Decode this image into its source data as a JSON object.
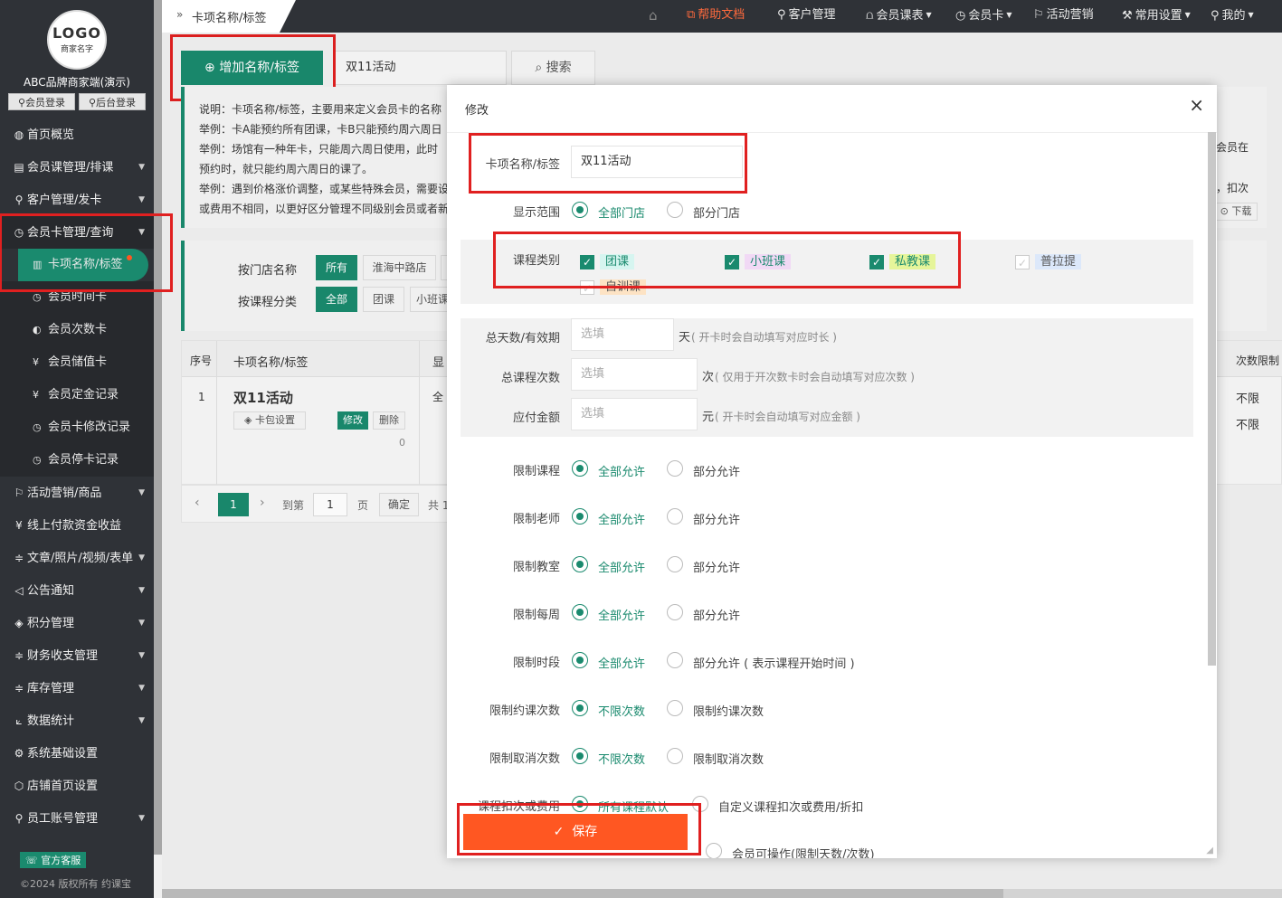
{
  "sidebar": {
    "logo_text": "LOGO",
    "logo_sub": "商家名字",
    "brand": "ABC品牌商家端(演示)",
    "member_login": "会员登录",
    "admin_login": "后台登录",
    "items": [
      {
        "icon": "globe-icon",
        "glyph": "◍",
        "label": "首页概览",
        "caret": false
      },
      {
        "icon": "course-icon",
        "glyph": "▤",
        "label": "会员课管理/排课",
        "caret": true
      },
      {
        "icon": "user-icon",
        "glyph": "⚲",
        "label": "客户管理/发卡",
        "caret": true
      },
      {
        "icon": "clock-icon",
        "glyph": "◷",
        "label": "会员卡管理/查询",
        "caret": true
      }
    ],
    "subitems": [
      {
        "glyph": "▥",
        "label": "卡项名称/标签"
      },
      {
        "glyph": "◷",
        "label": "会员时间卡"
      },
      {
        "glyph": "◐",
        "label": "会员次数卡"
      },
      {
        "glyph": "¥",
        "label": "会员储值卡"
      },
      {
        "glyph": "¥",
        "label": "会员定金记录"
      },
      {
        "glyph": "◷",
        "label": "会员卡修改记录"
      },
      {
        "glyph": "◷",
        "label": "会员停卡记录"
      }
    ],
    "items2": [
      {
        "glyph": "⚐",
        "label": "活动营销/商品",
        "caret": true
      },
      {
        "glyph": "¥",
        "label": "线上付款资金收益",
        "caret": false
      },
      {
        "glyph": "≑",
        "label": "文章/照片/视频/表单",
        "caret": true
      },
      {
        "glyph": "◁",
        "label": "公告通知",
        "caret": true
      },
      {
        "glyph": "◈",
        "label": "积分管理",
        "caret": true
      },
      {
        "glyph": "≑",
        "label": "财务收支管理",
        "caret": true
      },
      {
        "glyph": "≑",
        "label": "库存管理",
        "caret": true
      },
      {
        "glyph": "⟀",
        "label": "数据统计",
        "caret": true
      },
      {
        "glyph": "⚙",
        "label": "系统基础设置",
        "caret": false
      },
      {
        "glyph": "⬡",
        "label": "店铺首页设置",
        "caret": false
      },
      {
        "glyph": "⚲",
        "label": "员工账号管理",
        "caret": true
      }
    ],
    "service": "官方客服",
    "copyright": "©2024 版权所有 约课宝"
  },
  "topbar": {
    "breadcrumb": "卡项名称/标签",
    "home": "⌂",
    "nav": [
      {
        "label": "帮助文档",
        "glyph": "⧉",
        "caret": false,
        "highlight": true
      },
      {
        "label": "客户管理",
        "glyph": "⚲",
        "caret": false,
        "highlight": false
      },
      {
        "label": "会员课表",
        "glyph": "⩍",
        "caret": true,
        "highlight": false
      },
      {
        "label": "会员卡",
        "glyph": "◷",
        "caret": true,
        "highlight": false
      },
      {
        "label": "活动营销",
        "glyph": "⚐",
        "caret": false,
        "highlight": false
      },
      {
        "label": "常用设置",
        "glyph": "⚒",
        "caret": true,
        "highlight": false
      },
      {
        "label": "我的",
        "glyph": "⚲",
        "caret": true,
        "highlight": false
      }
    ]
  },
  "main": {
    "add_button": "增加名称/标签",
    "search_value": "双11活动",
    "search_button": "搜索",
    "notes": [
      "说明：卡项名称/标签，主要用来定义会员卡的名称",
      "举例：卡A能预约所有团课，卡B只能预约周六周日",
      "举例：场馆有一种年卡，只能周六周日使用，此时",
      "预约时，就只能约周六周日的课了。",
      "举例：遇到价格涨价调整，或某些特殊会员，需要设",
      "或费用不相同，以更好区分管理不同级别会员或者新"
    ],
    "note_right_1": "会员在",
    "note_right_2": "，扣次",
    "download": "下载",
    "filter_store_label": "按门店名称",
    "filter_store_options": [
      "所有",
      "淮海中路店"
    ],
    "filter_course_label": "按课程分类",
    "filter_course_options": [
      "全部",
      "团课",
      "小班课"
    ],
    "table": {
      "headers": [
        "序号",
        "卡项名称/标签",
        "显"
      ],
      "right_header": "次数限制",
      "row": {
        "index": "1",
        "name": "双11活动",
        "wallet": "卡包设置",
        "edit": "修改",
        "delete": "删除",
        "count": "0",
        "scope": "全",
        "limit1": "不限",
        "limit2": "不限"
      }
    },
    "pager": {
      "current": "1",
      "goto": "到第",
      "page_input": "1",
      "page": "页",
      "confirm": "确定",
      "total": "共 1"
    }
  },
  "modal": {
    "title": "修改",
    "close": "×",
    "name_label": "卡项名称/标签",
    "name_value": "双11活动",
    "scope_label": "显示范围",
    "scope_options": [
      "全部门店",
      "部分门店"
    ],
    "course_label": "课程类别",
    "courses": [
      {
        "label": "团课",
        "checked": true,
        "bg": "#d6f5f0"
      },
      {
        "label": "小班课",
        "checked": true,
        "bg": "#f1d9f5"
      },
      {
        "label": "私教课",
        "checked": true,
        "bg": "#e6f59a"
      },
      {
        "label": "普拉提",
        "checked": false,
        "bg": "#dce8fa"
      },
      {
        "label": "自训课",
        "checked": false,
        "bg": "#fde3c4"
      }
    ],
    "days_label": "总天数/有效期",
    "days_placeholder": "选填",
    "days_unit": "天",
    "days_hint": "( 开卡时会自动填写对应时长 )",
    "times_label": "总课程次数",
    "times_placeholder": "选填",
    "times_unit": "次",
    "times_hint": "( 仅用于开次数卡时会自动填写对应次数 )",
    "price_label": "应付金额",
    "price_placeholder": "选填",
    "price_unit": "元",
    "price_hint": "( 开卡时会自动填写对应金额 )",
    "limits": [
      {
        "label": "限制课程",
        "on": "全部允许",
        "off": "部分允许"
      },
      {
        "label": "限制老师",
        "on": "全部允许",
        "off": "部分允许"
      },
      {
        "label": "限制教室",
        "on": "全部允许",
        "off": "部分允许"
      },
      {
        "label": "限制每周",
        "on": "全部允许",
        "off": "部分允许"
      },
      {
        "label": "限制时段",
        "on": "全部允许",
        "off": "部分允许 ( 表示课程开始时间 )"
      },
      {
        "label": "限制约课次数",
        "on": "不限次数",
        "off": "限制约课次数"
      },
      {
        "label": "限制取消次数",
        "on": "不限次数",
        "off": "限制取消次数"
      }
    ],
    "deduct_label": "课程扣次或费用",
    "deduct_on": "所有课程默认",
    "deduct_off": "自定义课程扣次或费用/折扣",
    "member_op": "会员可操作(限制天数/次数)",
    "save": "保存"
  }
}
